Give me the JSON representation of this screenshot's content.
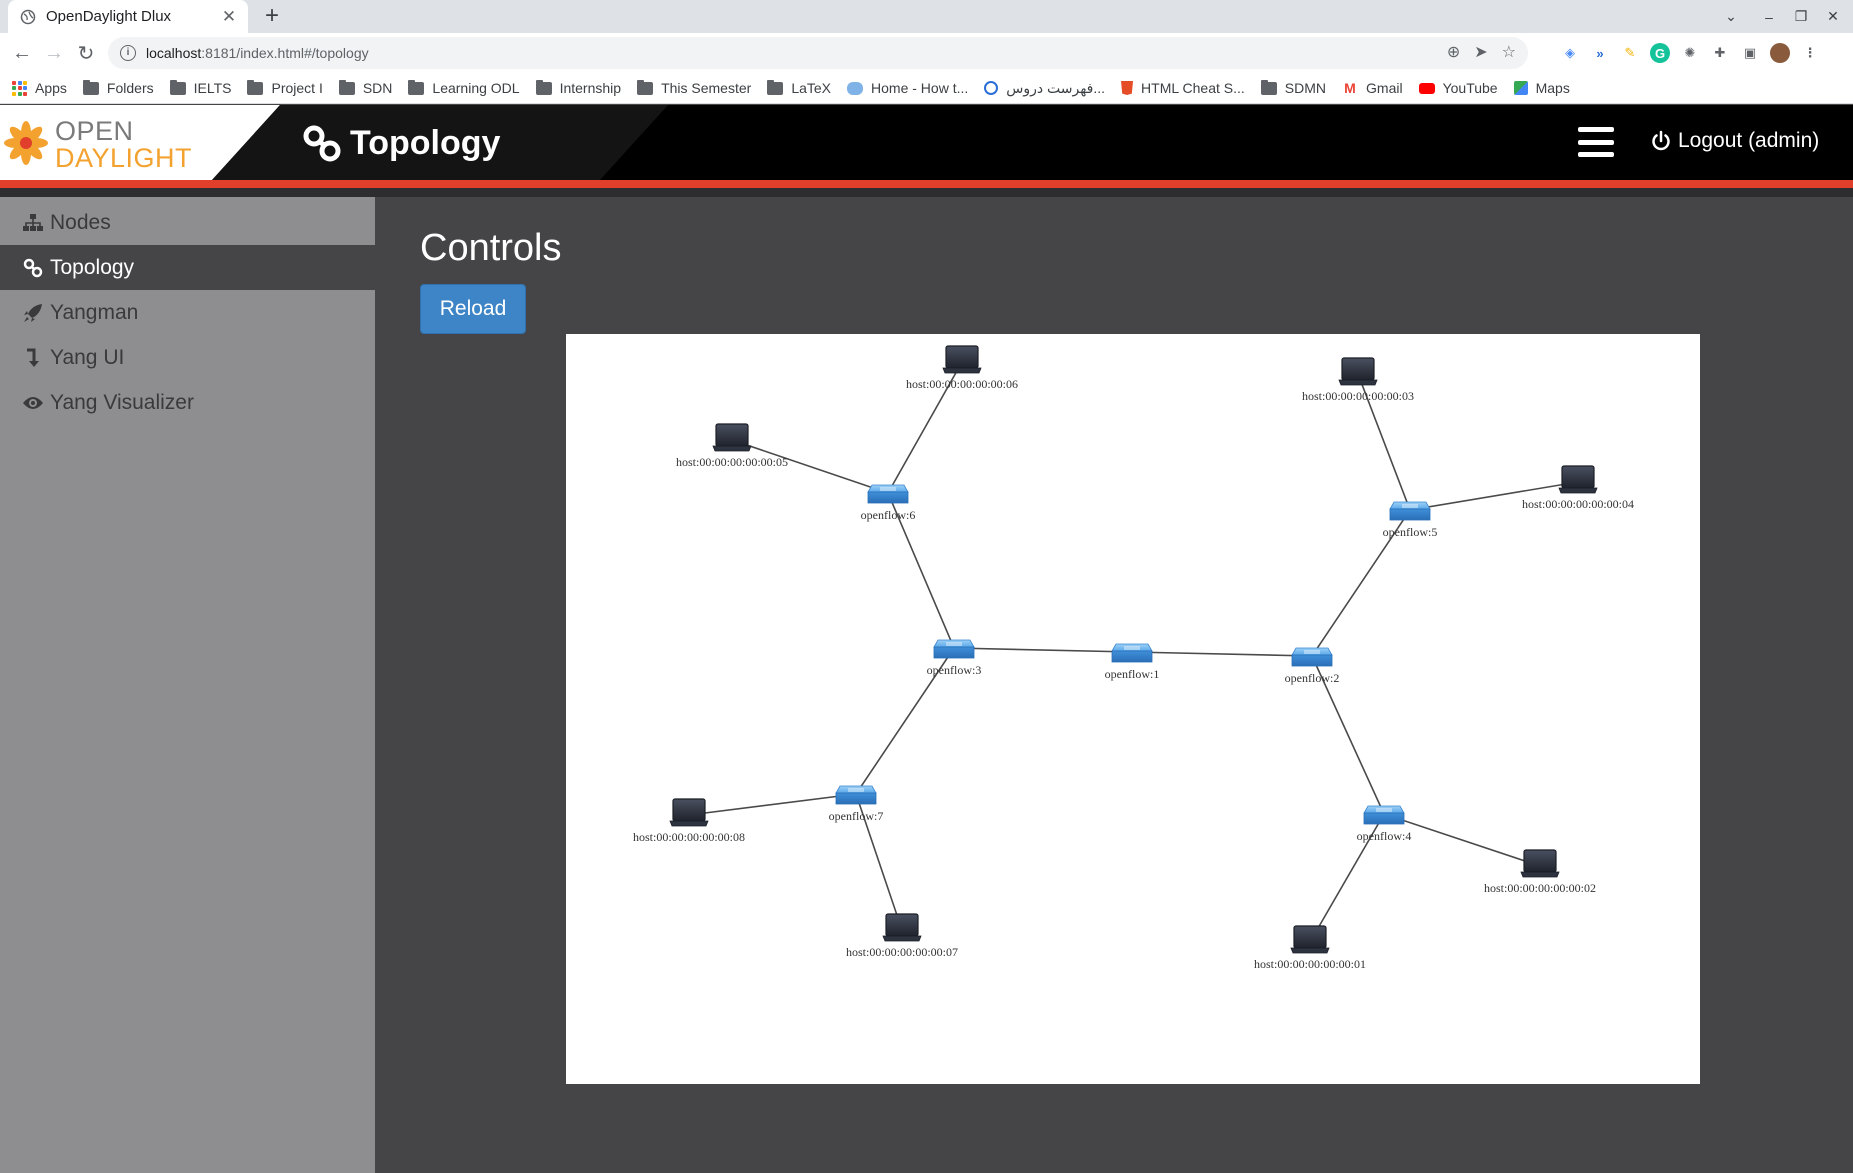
{
  "browser": {
    "tab_title": "OpenDaylight Dlux",
    "url_host": "localhost",
    "url_rest": ":8181/index.html#/topology",
    "bookmarks": [
      {
        "label": "Apps",
        "icon": "apps-grid-icon"
      },
      {
        "label": "Folders",
        "icon": "folder-icon"
      },
      {
        "label": "IELTS",
        "icon": "folder-icon"
      },
      {
        "label": "Project I",
        "icon": "folder-icon"
      },
      {
        "label": "SDN",
        "icon": "folder-icon"
      },
      {
        "label": "Learning ODL",
        "icon": "folder-icon"
      },
      {
        "label": "Internship",
        "icon": "folder-icon"
      },
      {
        "label": "This Semester",
        "icon": "folder-icon"
      },
      {
        "label": "LaTeX",
        "icon": "folder-icon"
      },
      {
        "label": "Home - How t...",
        "icon": "cloud-icon"
      },
      {
        "label": "فهرست دروس...",
        "icon": "globe-icon"
      },
      {
        "label": "HTML Cheat S...",
        "icon": "html5-icon"
      },
      {
        "label": "SDMN",
        "icon": "folder-icon"
      },
      {
        "label": "Gmail",
        "icon": "gmail-icon"
      },
      {
        "label": "YouTube",
        "icon": "youtube-icon"
      },
      {
        "label": "Maps",
        "icon": "maps-icon"
      }
    ]
  },
  "header": {
    "logo_top": "OPEN",
    "logo_bottom": "DAYLIGHT",
    "title": "Topology",
    "logout_label": "Logout (admin)"
  },
  "sidebar": {
    "items": [
      {
        "label": "Nodes",
        "icon": "sitemap-icon",
        "active": false
      },
      {
        "label": "Topology",
        "icon": "link-icon",
        "active": true
      },
      {
        "label": "Yangman",
        "icon": "rocket-icon",
        "active": false
      },
      {
        "label": "Yang UI",
        "icon": "level-down-icon",
        "active": false
      },
      {
        "label": "Yang Visualizer",
        "icon": "eye-icon",
        "active": false
      }
    ]
  },
  "main": {
    "controls_title": "Controls",
    "reload_label": "Reload"
  },
  "topology": {
    "switches": [
      {
        "id": "openflow:1",
        "label": "openflow:1"
      },
      {
        "id": "openflow:2",
        "label": "openflow:2"
      },
      {
        "id": "openflow:3",
        "label": "openflow:3"
      },
      {
        "id": "openflow:4",
        "label": "openflow:4"
      },
      {
        "id": "openflow:5",
        "label": "openflow:5"
      },
      {
        "id": "openflow:6",
        "label": "openflow:6"
      },
      {
        "id": "openflow:7",
        "label": "openflow:7"
      }
    ],
    "hosts": [
      {
        "id": "host:00:00:00:00:00:01",
        "label": "host:00:00:00:00:00:01"
      },
      {
        "id": "host:00:00:00:00:00:02",
        "label": "host:00:00:00:00:00:02"
      },
      {
        "id": "host:00:00:00:00:00:03",
        "label": "host:00:00:00:00:00:03"
      },
      {
        "id": "host:00:00:00:00:00:04",
        "label": "host:00:00:00:00:00:04"
      },
      {
        "id": "host:00:00:00:00:00:05",
        "label": "host:00:00:00:00:00:05"
      },
      {
        "id": "host:00:00:00:00:00:06",
        "label": "host:00:00:00:00:00:06"
      },
      {
        "id": "host:00:00:00:00:00:07",
        "label": "host:00:00:00:00:00:07"
      },
      {
        "id": "host:00:00:00:00:00:08",
        "label": "host:00:00:00:00:00:08"
      }
    ],
    "links": [
      [
        "openflow:1",
        "openflow:3"
      ],
      [
        "openflow:1",
        "openflow:2"
      ],
      [
        "openflow:3",
        "openflow:6"
      ],
      [
        "openflow:3",
        "openflow:7"
      ],
      [
        "openflow:2",
        "openflow:5"
      ],
      [
        "openflow:2",
        "openflow:4"
      ],
      [
        "openflow:6",
        "host:00:00:00:00:00:05"
      ],
      [
        "openflow:6",
        "host:00:00:00:00:00:06"
      ],
      [
        "openflow:5",
        "host:00:00:00:00:00:03"
      ],
      [
        "openflow:5",
        "host:00:00:00:00:00:04"
      ],
      [
        "openflow:7",
        "host:00:00:00:00:00:08"
      ],
      [
        "openflow:7",
        "host:00:00:00:00:00:07"
      ],
      [
        "openflow:4",
        "host:00:00:00:00:00:01"
      ],
      [
        "openflow:4",
        "host:00:00:00:00:00:02"
      ]
    ]
  },
  "colors": {
    "accent_red": "#e13f2c",
    "logo_orange": "#f3a230",
    "reload_blue": "#3d85c6",
    "switch_blue": "#3f8fd8",
    "host_dark": "#2e3340"
  }
}
